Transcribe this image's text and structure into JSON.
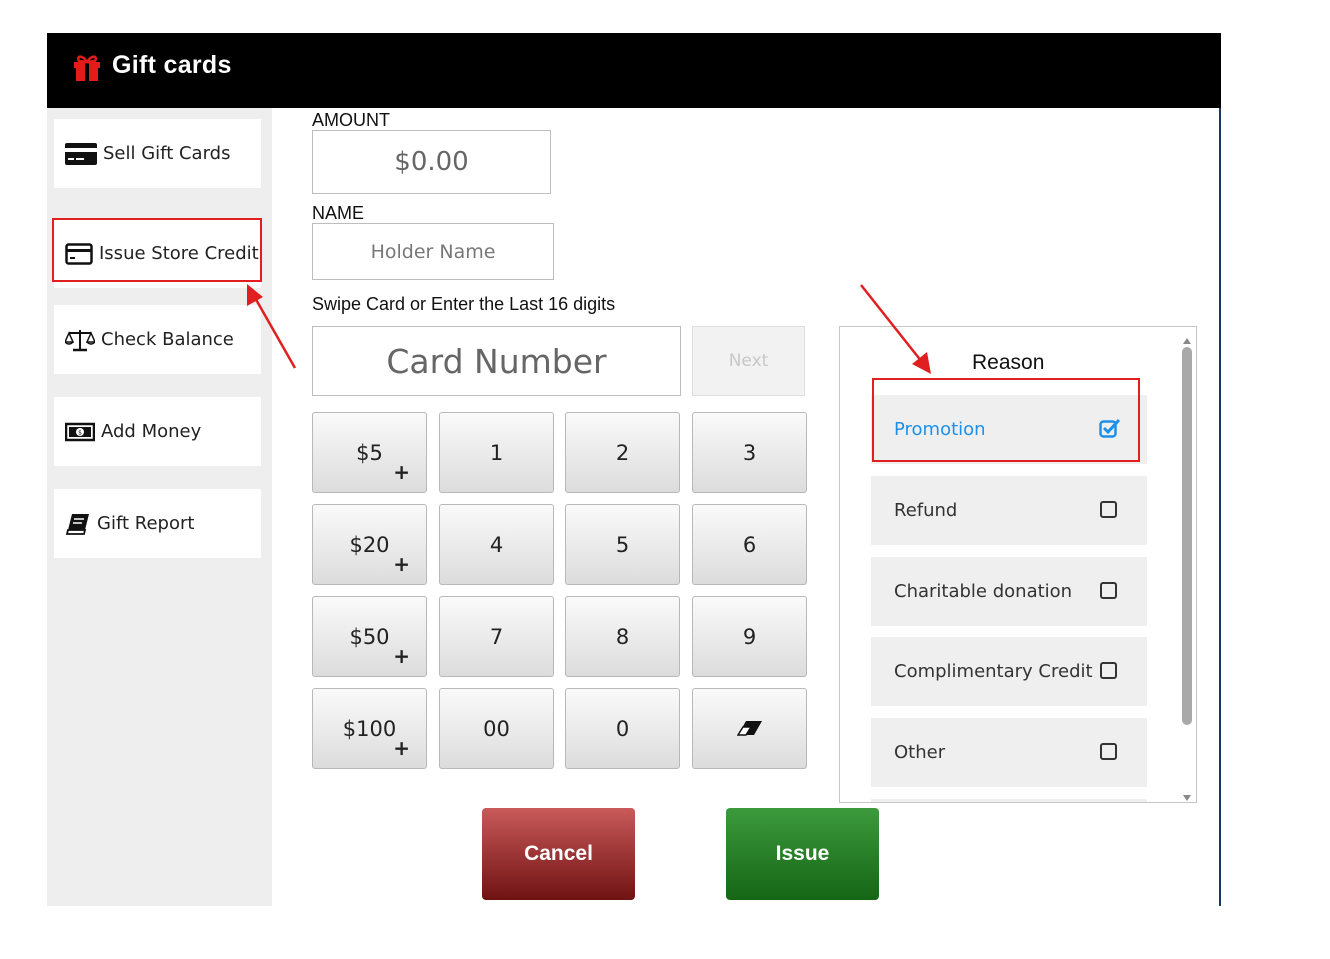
{
  "window": {
    "title": "Gift cards",
    "title_icon": "gift-icon"
  },
  "sidebar": {
    "items": [
      {
        "label": "Sell Gift Cards",
        "icon": "credit-card-icon"
      },
      {
        "label": "Issue Store Credit",
        "icon": "card-outline-icon"
      },
      {
        "label": "Check Balance",
        "icon": "balance-scale-icon"
      },
      {
        "label": "Add Money",
        "icon": "money-bill-icon"
      },
      {
        "label": "Gift Report",
        "icon": "book-icon"
      }
    ]
  },
  "form": {
    "amount_label": "AMOUNT",
    "amount_value": "$0.00",
    "name_label": "NAME",
    "name_placeholder": "Holder Name",
    "card_label": "Swipe Card or Enter the Last 16 digits",
    "card_placeholder": "Card Number",
    "next_label": "Next"
  },
  "keypad": {
    "rows": [
      [
        "$5",
        "1",
        "2",
        "3"
      ],
      [
        "$20",
        "4",
        "5",
        "6"
      ],
      [
        "$50",
        "7",
        "8",
        "9"
      ],
      [
        "$100",
        "00",
        "0",
        "eraser"
      ]
    ],
    "plus": "+"
  },
  "reason": {
    "title": "Reason",
    "items": [
      {
        "label": "Promotion",
        "checked": true
      },
      {
        "label": "Refund",
        "checked": false
      },
      {
        "label": "Charitable donation",
        "checked": false
      },
      {
        "label": "Complimentary Credit",
        "checked": false
      },
      {
        "label": "Other",
        "checked": false
      }
    ]
  },
  "actions": {
    "cancel": "Cancel",
    "issue": "Issue"
  },
  "colors": {
    "accent": "#1e90e8",
    "highlight": "#e02020",
    "cancel": "#8b1a1a",
    "issue": "#1e7a1e"
  }
}
